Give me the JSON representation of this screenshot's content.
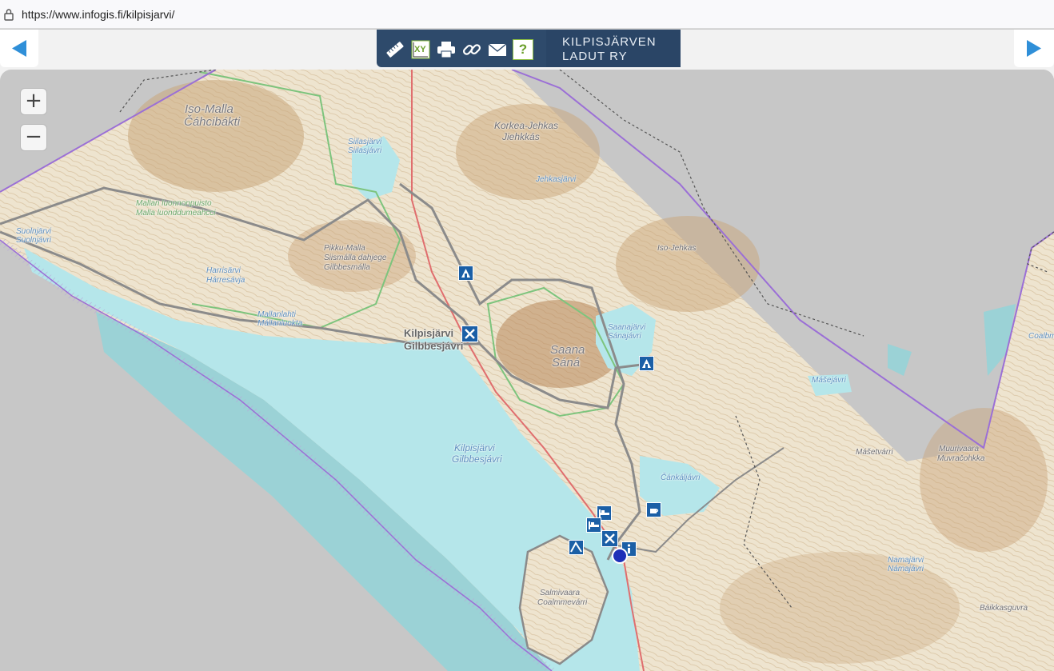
{
  "browser": {
    "url": "https://www.infogis.fi/kilpisjarvi/"
  },
  "header": {
    "title_line1": "KILPISJÄRVEN",
    "title_line2": "LADUT RY",
    "tools": [
      {
        "name": "measure",
        "icon": "ruler-icon"
      },
      {
        "name": "coordinates",
        "icon": "xy-coordinates-icon",
        "label": "XY"
      },
      {
        "name": "print",
        "icon": "printer-icon"
      },
      {
        "name": "link",
        "icon": "link-icon"
      },
      {
        "name": "email",
        "icon": "envelope-icon"
      },
      {
        "name": "help",
        "icon": "help-icon",
        "label": "?"
      }
    ],
    "accent_color": "#2e4a6b"
  },
  "navigation": {
    "prev_icon": "arrow-left-icon",
    "next_icon": "arrow-right-icon"
  },
  "zoom": {
    "in_label": "+",
    "out_label": "−"
  },
  "map_labels": {
    "iso_malla": "Iso-Malla",
    "iso_malla_sami": "Čáhcibákti",
    "siilasjarvi": "Siilasjärvi",
    "siilasjarvi_sami": "Siilasjávri",
    "mallan_luonnonpuisto": "Mallan luonnonpuisto",
    "malla_luonddumeahcci": "Malla luonddumeahcci",
    "pikku_malla": "Pikku-Malla",
    "pikku_malla_sami1": "Siismálla dahjege",
    "pikku_malla_sami2": "Gilbbesmálla",
    "harrisarvi": "Harrisärvi",
    "harrisarvi_sami": "Hárresávja",
    "mallanlahti": "Mallanlahti",
    "mallanlahti_sami": "Mállanluokta",
    "kilpisjarvi_village": "Kilpisjärvi",
    "gilbbesjavri_village": "Gilbbesjávri",
    "kilpisjarvi_lake": "Kilpisjärvi",
    "gilbbesjavri_lake": "Gilbbesjávri",
    "korkea_jehkas": "Korkea-Jehkas",
    "jiehkkas": "Jiehkkás",
    "iso_jehkas": "Iso-Jehkas",
    "saana": "Saana",
    "saana_sami": "Sáná",
    "saanajarvi": "Saanajärvi",
    "saanajarvi_sami": "Sánajávri",
    "masejavri": "Mášejávri",
    "masetvarri": "Mášetvárri",
    "muurivaara": "Muurivaara",
    "muvracohkka": "Muvračohkka",
    "cankaljavri": "Čánkáljávri",
    "salmivaara": "Salmivaara",
    "coalmmevarri": "Coalmmevárri",
    "baikkasguvra": "Báikkasguvra",
    "coalbmi": "Coalbmi",
    "namajavri": "Namajärvi",
    "namajavri_sami": "Námajávri",
    "suolnjarvi": "Suolnjärvi",
    "suolnjarvi_sami": "Suolnjávri",
    "lisatieto": "Jehkasjärvi",
    "colors": {
      "water": "#b5e6ea",
      "land": "#f1ead8",
      "deep_water": "#9bd2d6",
      "outside": "#c7c7c7",
      "border": "#9b6fd6"
    }
  },
  "pois": [
    {
      "type": "cabin",
      "icon": "cabin-icon"
    },
    {
      "type": "restaurant",
      "icon": "restaurant-icon"
    },
    {
      "type": "cabin",
      "icon": "cabin-icon"
    },
    {
      "type": "accommodation",
      "icon": "bed-icon"
    },
    {
      "type": "accommodation",
      "icon": "bed-icon"
    },
    {
      "type": "cafe",
      "icon": "cafe-icon"
    },
    {
      "type": "restaurant",
      "icon": "restaurant-icon"
    },
    {
      "type": "info",
      "icon": "info-icon"
    },
    {
      "type": "shelter",
      "icon": "shelter-icon"
    },
    {
      "type": "user-location",
      "icon": "location-marker-icon"
    }
  ]
}
